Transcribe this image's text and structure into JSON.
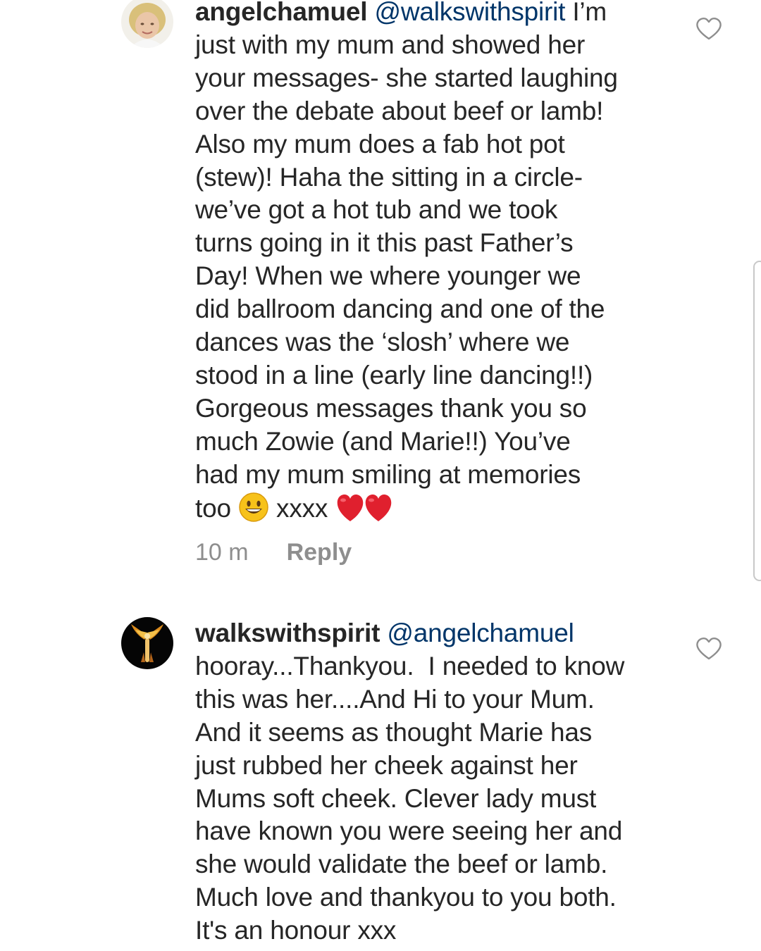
{
  "comments": [
    {
      "username": "angelchamuel",
      "mention": "@walkswithspirit",
      "first_text": " I’m",
      "lines": [
        "just with my mum and showed her",
        "your messages- she started laughing",
        "over the debate about beef or lamb!",
        "Also my mum does a fab hot pot",
        "(stew)! Haha the sitting in a circle-",
        "we’ve got a hot tub and we took",
        "turns going in it this past Father’s",
        "Day! When we where younger we",
        "did ballroom dancing and one of the",
        "dances was the ‘slosh’ where we",
        "stood in a line (early line dancing!!)",
        "Gorgeous messages thank you so",
        "much Zowie (and Marie!!) You’ve",
        "had my mum smiling at memories"
      ],
      "last_prefix": "too",
      "last_suffix": "xxxx",
      "time": "10 m",
      "reply_label": "Reply"
    },
    {
      "username": "walkswithspirit",
      "mention": "@angelchamuel",
      "lines": [
        "hooray...Thankyou.  I needed to know",
        "this was her....And Hi to your Mum.",
        "And it seems as thought Marie has",
        "just rubbed her cheek against her",
        "Mums soft cheek. Clever lady must",
        "have known you were seeing her and",
        "she would validate the beef or lamb.",
        "Much love and thankyou to you both.",
        "It's an honour xxx"
      ]
    }
  ],
  "icons": {
    "like": "heart-outline-icon",
    "smiley": "grinning-face-emoji",
    "heart": "red-heart-emoji"
  },
  "colors": {
    "text": "#262626",
    "mention": "#003569",
    "meta": "#8e8e8e",
    "heart_emoji": "#e0202e",
    "smiley_emoji": "#f7c21a"
  }
}
